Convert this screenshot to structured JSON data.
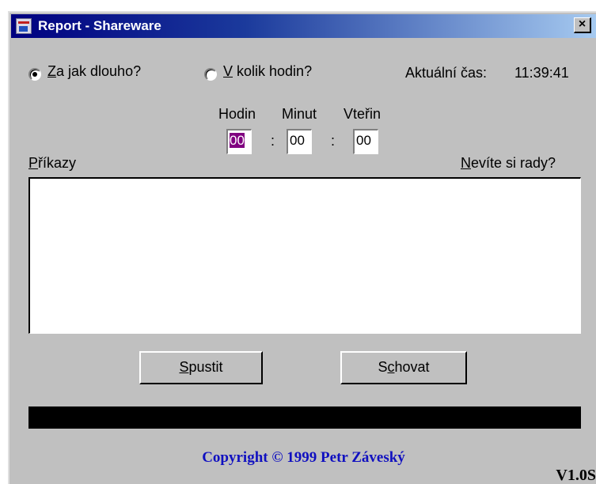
{
  "window": {
    "title": "Report - Shareware",
    "close_glyph": "×"
  },
  "mode": {
    "option1_label": "Za jak dlouho?",
    "option1_hotkey": "Z",
    "option1_rest": "a jak dlouho?",
    "option2_label": "V kolik hodin?",
    "option2_hotkey": "V",
    "option2_rest": " kolik hodin?",
    "selected": "option1"
  },
  "clock": {
    "label": "Aktuální čas:",
    "time": "11:39:41"
  },
  "timer": {
    "hours_label": "Hodin",
    "minutes_label": "Minut",
    "seconds_label": "Vteřin",
    "hours_value": "00",
    "minutes_value": "00",
    "seconds_value": "00",
    "separator": ":"
  },
  "commands": {
    "label": "Příkazy",
    "hotkey": "P",
    "rest": "říkazy",
    "text": ""
  },
  "help_link": {
    "label": "Nevíte si rady?",
    "hotkey": "N",
    "rest": "evíte si rady?"
  },
  "buttons": {
    "start_label": "Spustit",
    "start_hotkey": "S",
    "start_rest": "pustit",
    "hide_label": "Schovat",
    "hide_pre": "S",
    "hide_hotkey": "c",
    "hide_rest": "hovat"
  },
  "progress": {
    "value": 0
  },
  "footer": {
    "copyright": "Copyright © 1999 Petr Záveský",
    "version": "V1.0S"
  },
  "colors": {
    "titlebar_start": "#000080",
    "titlebar_end": "#a6caf0",
    "window_bg": "#c0c0c0",
    "selection": "#800080",
    "copyright": "#1010c0"
  },
  "icons": [
    "app-icon",
    "close-icon"
  ]
}
